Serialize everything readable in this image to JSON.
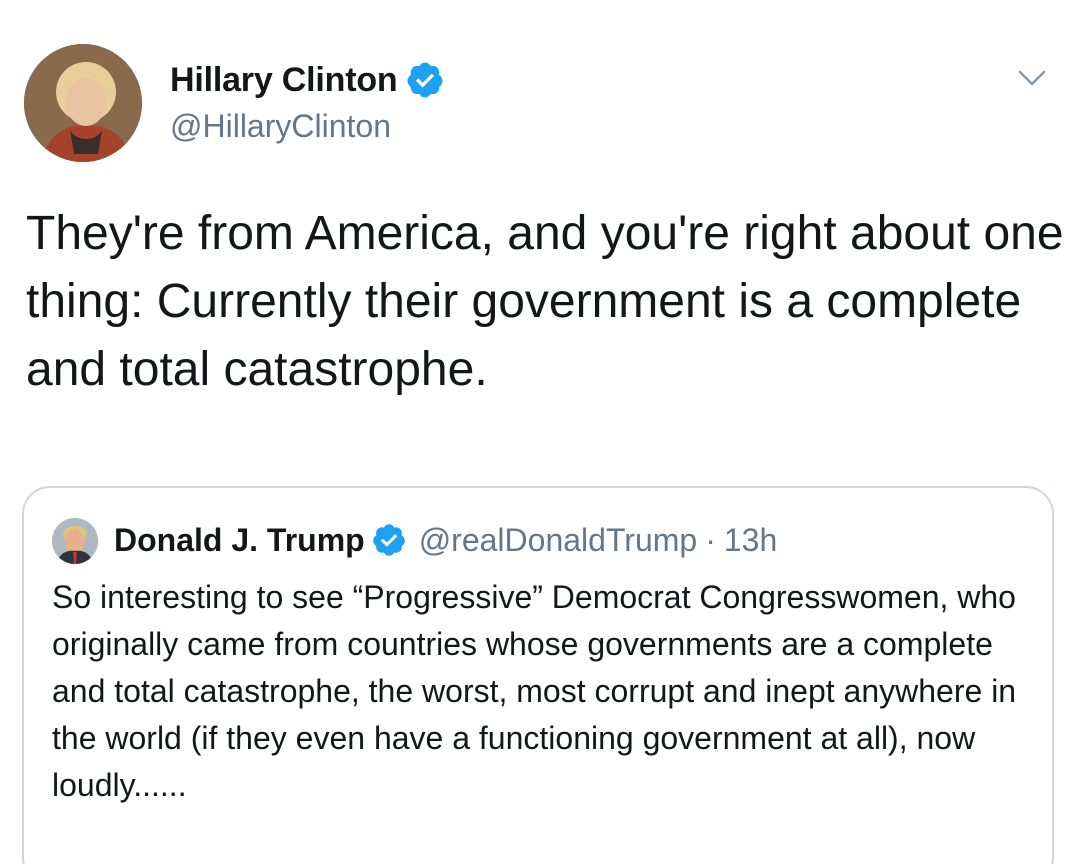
{
  "tweet": {
    "author": {
      "name": "Hillary Clinton",
      "handle": "@HillaryClinton",
      "verified": true,
      "avatar_icon": "profile-photo"
    },
    "menu_icon": "chevron-down-icon",
    "text": "They're from America, and you're right about one thing: Currently their government is a complete and total catastrophe."
  },
  "quoted_tweet": {
    "author": {
      "name": "Donald J. Trump",
      "handle": "@realDonaldTrump",
      "verified": true,
      "avatar_icon": "profile-photo"
    },
    "separator": "·",
    "time": "13h",
    "text": "So interesting to see “Progressive” Democrat Congresswomen, who originally came from countries whose governments are a complete and total catastrophe, the worst, most corrupt and inept anywhere in the world (if they even have a functioning government at all), now loudly......"
  },
  "colors": {
    "verified_blue": "#1da1f2",
    "secondary_text": "#657786",
    "border": "#ccd6dd",
    "primary_text": "#14171a"
  }
}
